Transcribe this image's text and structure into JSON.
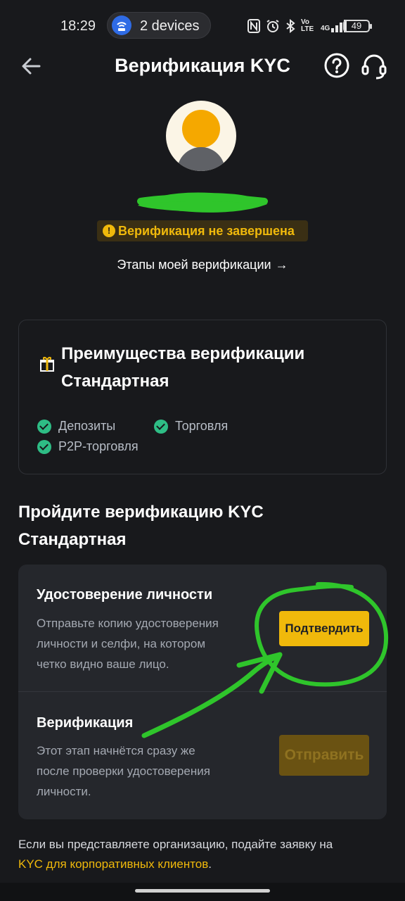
{
  "status_bar": {
    "time": "18:29",
    "devices_label": "2 devices",
    "icons": [
      "nfc-icon",
      "alarm-icon",
      "bluetooth-icon",
      "volte-icon",
      "signal-4g-icon",
      "battery-icon"
    ],
    "network_label": "4G",
    "volte_label": "Vo LTE",
    "battery_level": "49"
  },
  "header": {
    "title": "Верификация KYC"
  },
  "profile": {
    "status_badge": "Верификация не завершена",
    "status_color": "#f0b90b",
    "steps_link": "Этапы моей верификации"
  },
  "benefits_card": {
    "title_line1": "Преимущества верификации",
    "title_line2": "Стандартная",
    "features": [
      "Депозиты",
      "Торговля",
      "P2P-торговля"
    ]
  },
  "kyc_section": {
    "title_line1": "Пройдите верификацию KYC",
    "title_line2": "Стандартная"
  },
  "steps": [
    {
      "title": "Удостоверение личности",
      "desc_lines": [
        "Отправьте копию удостоверения",
        "личности и селфи, на котором",
        "четко видно ваше лицо."
      ],
      "button": "Подтвердить"
    },
    {
      "title": "Верификация",
      "desc_lines": [
        "Этот этап начнётся сразу же",
        "после проверки удостоверения",
        "личности."
      ],
      "button": "Отправить"
    }
  ],
  "footer": {
    "text": "Если вы представляете организацию, подайте заявку на",
    "link": "KYC для корпоративных клиентов",
    "suffix": "."
  },
  "colors": {
    "background": "#18191c",
    "accent": "#f0b90b",
    "success": "#2ebd85",
    "annotation_green": "#2fc52b"
  }
}
